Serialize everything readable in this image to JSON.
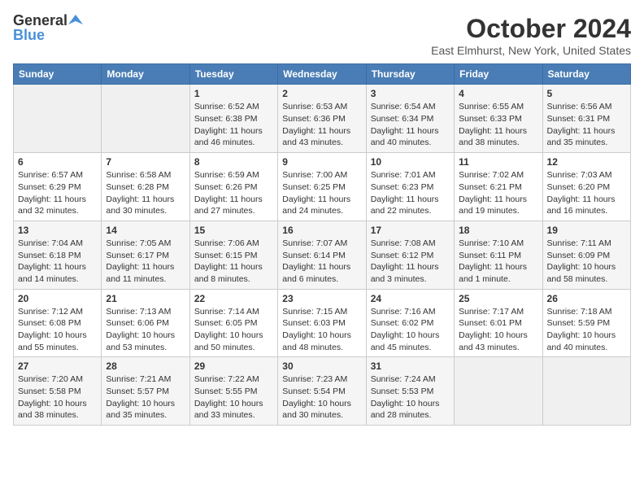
{
  "header": {
    "logo_general": "General",
    "logo_blue": "Blue",
    "month_title": "October 2024",
    "location": "East Elmhurst, New York, United States"
  },
  "days_of_week": [
    "Sunday",
    "Monday",
    "Tuesday",
    "Wednesday",
    "Thursday",
    "Friday",
    "Saturday"
  ],
  "weeks": [
    [
      {
        "day": "",
        "info": ""
      },
      {
        "day": "",
        "info": ""
      },
      {
        "day": "1",
        "info": "Sunrise: 6:52 AM\nSunset: 6:38 PM\nDaylight: 11 hours and 46 minutes."
      },
      {
        "day": "2",
        "info": "Sunrise: 6:53 AM\nSunset: 6:36 PM\nDaylight: 11 hours and 43 minutes."
      },
      {
        "day": "3",
        "info": "Sunrise: 6:54 AM\nSunset: 6:34 PM\nDaylight: 11 hours and 40 minutes."
      },
      {
        "day": "4",
        "info": "Sunrise: 6:55 AM\nSunset: 6:33 PM\nDaylight: 11 hours and 38 minutes."
      },
      {
        "day": "5",
        "info": "Sunrise: 6:56 AM\nSunset: 6:31 PM\nDaylight: 11 hours and 35 minutes."
      }
    ],
    [
      {
        "day": "6",
        "info": "Sunrise: 6:57 AM\nSunset: 6:29 PM\nDaylight: 11 hours and 32 minutes."
      },
      {
        "day": "7",
        "info": "Sunrise: 6:58 AM\nSunset: 6:28 PM\nDaylight: 11 hours and 30 minutes."
      },
      {
        "day": "8",
        "info": "Sunrise: 6:59 AM\nSunset: 6:26 PM\nDaylight: 11 hours and 27 minutes."
      },
      {
        "day": "9",
        "info": "Sunrise: 7:00 AM\nSunset: 6:25 PM\nDaylight: 11 hours and 24 minutes."
      },
      {
        "day": "10",
        "info": "Sunrise: 7:01 AM\nSunset: 6:23 PM\nDaylight: 11 hours and 22 minutes."
      },
      {
        "day": "11",
        "info": "Sunrise: 7:02 AM\nSunset: 6:21 PM\nDaylight: 11 hours and 19 minutes."
      },
      {
        "day": "12",
        "info": "Sunrise: 7:03 AM\nSunset: 6:20 PM\nDaylight: 11 hours and 16 minutes."
      }
    ],
    [
      {
        "day": "13",
        "info": "Sunrise: 7:04 AM\nSunset: 6:18 PM\nDaylight: 11 hours and 14 minutes."
      },
      {
        "day": "14",
        "info": "Sunrise: 7:05 AM\nSunset: 6:17 PM\nDaylight: 11 hours and 11 minutes."
      },
      {
        "day": "15",
        "info": "Sunrise: 7:06 AM\nSunset: 6:15 PM\nDaylight: 11 hours and 8 minutes."
      },
      {
        "day": "16",
        "info": "Sunrise: 7:07 AM\nSunset: 6:14 PM\nDaylight: 11 hours and 6 minutes."
      },
      {
        "day": "17",
        "info": "Sunrise: 7:08 AM\nSunset: 6:12 PM\nDaylight: 11 hours and 3 minutes."
      },
      {
        "day": "18",
        "info": "Sunrise: 7:10 AM\nSunset: 6:11 PM\nDaylight: 11 hours and 1 minute."
      },
      {
        "day": "19",
        "info": "Sunrise: 7:11 AM\nSunset: 6:09 PM\nDaylight: 10 hours and 58 minutes."
      }
    ],
    [
      {
        "day": "20",
        "info": "Sunrise: 7:12 AM\nSunset: 6:08 PM\nDaylight: 10 hours and 55 minutes."
      },
      {
        "day": "21",
        "info": "Sunrise: 7:13 AM\nSunset: 6:06 PM\nDaylight: 10 hours and 53 minutes."
      },
      {
        "day": "22",
        "info": "Sunrise: 7:14 AM\nSunset: 6:05 PM\nDaylight: 10 hours and 50 minutes."
      },
      {
        "day": "23",
        "info": "Sunrise: 7:15 AM\nSunset: 6:03 PM\nDaylight: 10 hours and 48 minutes."
      },
      {
        "day": "24",
        "info": "Sunrise: 7:16 AM\nSunset: 6:02 PM\nDaylight: 10 hours and 45 minutes."
      },
      {
        "day": "25",
        "info": "Sunrise: 7:17 AM\nSunset: 6:01 PM\nDaylight: 10 hours and 43 minutes."
      },
      {
        "day": "26",
        "info": "Sunrise: 7:18 AM\nSunset: 5:59 PM\nDaylight: 10 hours and 40 minutes."
      }
    ],
    [
      {
        "day": "27",
        "info": "Sunrise: 7:20 AM\nSunset: 5:58 PM\nDaylight: 10 hours and 38 minutes."
      },
      {
        "day": "28",
        "info": "Sunrise: 7:21 AM\nSunset: 5:57 PM\nDaylight: 10 hours and 35 minutes."
      },
      {
        "day": "29",
        "info": "Sunrise: 7:22 AM\nSunset: 5:55 PM\nDaylight: 10 hours and 33 minutes."
      },
      {
        "day": "30",
        "info": "Sunrise: 7:23 AM\nSunset: 5:54 PM\nDaylight: 10 hours and 30 minutes."
      },
      {
        "day": "31",
        "info": "Sunrise: 7:24 AM\nSunset: 5:53 PM\nDaylight: 10 hours and 28 minutes."
      },
      {
        "day": "",
        "info": ""
      },
      {
        "day": "",
        "info": ""
      }
    ]
  ]
}
